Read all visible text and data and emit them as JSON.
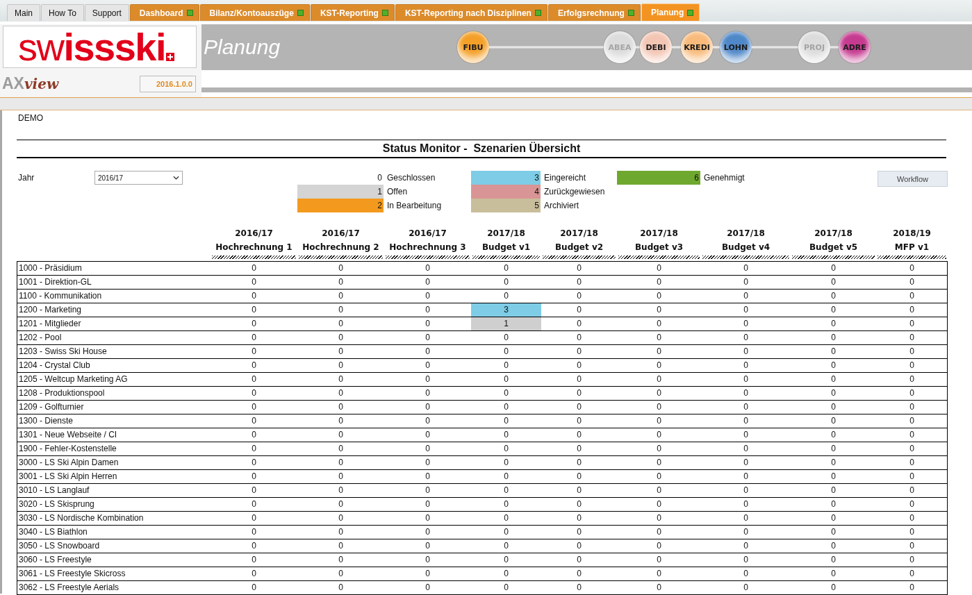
{
  "tabs": [
    {
      "label": "Main",
      "kind": "link",
      "selected": false
    },
    {
      "label": "How To",
      "kind": "link",
      "selected": false
    },
    {
      "label": "Support",
      "kind": "link",
      "selected": false
    },
    {
      "label": "Dashboard",
      "kind": "module",
      "selected": false
    },
    {
      "label": "Bilanz/Kontoauszüge",
      "kind": "module",
      "selected": false
    },
    {
      "label": "KST-Reporting",
      "kind": "module",
      "selected": false
    },
    {
      "label": "KST-Reporting nach Disziplinen",
      "kind": "module",
      "selected": false
    },
    {
      "label": "Erfolgsrechnung",
      "kind": "module",
      "selected": false
    },
    {
      "label": "Planung",
      "kind": "module",
      "selected": true
    }
  ],
  "header": {
    "logo": "sw**issski**",
    "product_logo": {
      "prefix": "AX",
      "suffix": "view"
    },
    "version": "2016.1.0.0",
    "title": "Planung",
    "modules": [
      {
        "label": "FIBU",
        "color": "#f4a028",
        "disabled": false
      },
      {
        "label": "ABEA",
        "color": "#dcdcdc",
        "disabled": true
      },
      {
        "label": "DEBI",
        "color": "#f3c6b4",
        "disabled": false
      },
      {
        "label": "KREDI",
        "color": "#f8bb7c",
        "disabled": false
      },
      {
        "label": "LOHN",
        "color": "#4f88c8",
        "disabled": false
      },
      {
        "label": "PROJ",
        "color": "#dcdcdc",
        "disabled": true
      },
      {
        "label": "ADRE",
        "color": "#c63a90",
        "disabled": false
      }
    ]
  },
  "client": "DEMO",
  "title": "Status Monitor -  Szenarien Übersicht",
  "year_filter": {
    "label": "Jahr",
    "value": "2016/17"
  },
  "legend": [
    {
      "code": "0",
      "label": "Geschlossen"
    },
    {
      "code": "1",
      "label": "Offen",
      "color": "#d4d4d4"
    },
    {
      "code": "2",
      "label": "In Bearbeitung",
      "color": "#f39a1e"
    },
    {
      "code": "3",
      "label": "Eingereicht",
      "color": "#7ecce6"
    },
    {
      "code": "4",
      "label": "Zurückgewiesen",
      "color": "#d99595"
    },
    {
      "code": "5",
      "label": "Archiviert",
      "color": "#c9be9b"
    },
    {
      "code": "6",
      "label": "Genehmigt",
      "color": "#6fa82e"
    }
  ],
  "workflow_button": "Workflow",
  "table": {
    "columns": [
      {
        "year": "2016/17",
        "name": "Hochrechnung 1"
      },
      {
        "year": "2016/17",
        "name": "Hochrechnung 2"
      },
      {
        "year": "2016/17",
        "name": "Hochrechnung 3"
      },
      {
        "year": "2017/18",
        "name": "Budget v1"
      },
      {
        "year": "2017/18",
        "name": "Budget v2"
      },
      {
        "year": "2017/18",
        "name": "Budget v3"
      },
      {
        "year": "2017/18",
        "name": "Budget v4"
      },
      {
        "year": "2017/18",
        "name": "Budget v5"
      },
      {
        "year": "2018/19",
        "name": "MFP v1"
      }
    ],
    "rows": [
      {
        "label": "1000 - Präsidium",
        "cells": [
          "0",
          "0",
          "0",
          "0",
          "0",
          "0",
          "0",
          "0",
          "0"
        ]
      },
      {
        "label": "1001 - Direktion-GL",
        "cells": [
          "0",
          "0",
          "0",
          "0",
          "0",
          "0",
          "0",
          "0",
          "0"
        ]
      },
      {
        "label": "1100 - Kommunikation",
        "cells": [
          "0",
          "0",
          "0",
          "0",
          "0",
          "0",
          "0",
          "0",
          "0"
        ]
      },
      {
        "label": "1200 - Marketing",
        "cells": [
          "0",
          "0",
          "0",
          {
            "text": "3",
            "color": "#7ecce6"
          },
          "0",
          "0",
          "0",
          "0",
          "0"
        ]
      },
      {
        "label": "1201 - Mitglieder",
        "cells": [
          "0",
          "0",
          "0",
          {
            "text": "1",
            "color": "#cfcfcf"
          },
          "0",
          "0",
          "0",
          "0",
          "0"
        ]
      },
      {
        "label": "1202 - Pool",
        "cells": [
          "0",
          "0",
          "0",
          "0",
          "0",
          "0",
          "0",
          "0",
          "0"
        ]
      },
      {
        "label": "1203 - Swiss Ski House",
        "cells": [
          "0",
          "0",
          "0",
          "0",
          "0",
          "0",
          "0",
          "0",
          "0"
        ]
      },
      {
        "label": "1204 - Crystal Club",
        "cells": [
          "0",
          "0",
          "0",
          "0",
          "0",
          "0",
          "0",
          "0",
          "0"
        ]
      },
      {
        "label": "1205 - Weltcup Marketing AG",
        "cells": [
          "0",
          "0",
          "0",
          "0",
          "0",
          "0",
          "0",
          "0",
          "0"
        ]
      },
      {
        "label": "1208 - Produktionspool",
        "cells": [
          "0",
          "0",
          "0",
          "0",
          "0",
          "0",
          "0",
          "0",
          "0"
        ]
      },
      {
        "label": "1209 - Golfturnier",
        "cells": [
          "0",
          "0",
          "0",
          "0",
          "0",
          "0",
          "0",
          "0",
          "0"
        ]
      },
      {
        "label": "1300 - Dienste",
        "cells": [
          "0",
          "0",
          "0",
          "0",
          "0",
          "0",
          "0",
          "0",
          "0"
        ]
      },
      {
        "label": "1301 - Neue Webseite / CI",
        "cells": [
          "0",
          "0",
          "0",
          "0",
          "0",
          "0",
          "0",
          "0",
          "0"
        ]
      },
      {
        "label": "1900 - Fehler-Kostenstelle",
        "cells": [
          "0",
          "0",
          "0",
          "0",
          "0",
          "0",
          "0",
          "0",
          "0"
        ]
      },
      {
        "label": "3000 - LS Ski Alpin Damen",
        "cells": [
          "0",
          "0",
          "0",
          "0",
          "0",
          "0",
          "0",
          "0",
          "0"
        ]
      },
      {
        "label": "3001 - LS Ski Alpin Herren",
        "cells": [
          "0",
          "0",
          "0",
          "0",
          "0",
          "0",
          "0",
          "0",
          "0"
        ]
      },
      {
        "label": "3010 - LS Langlauf",
        "cells": [
          "0",
          "0",
          "0",
          "0",
          "0",
          "0",
          "0",
          "0",
          "0"
        ]
      },
      {
        "label": "3020 - LS Skisprung",
        "cells": [
          "0",
          "0",
          "0",
          "0",
          "0",
          "0",
          "0",
          "0",
          "0"
        ]
      },
      {
        "label": "3030 - LS Nordische Kombination",
        "cells": [
          "0",
          "0",
          "0",
          "0",
          "0",
          "0",
          "0",
          "0",
          "0"
        ]
      },
      {
        "label": "3040 - LS Biathlon",
        "cells": [
          "0",
          "0",
          "0",
          "0",
          "0",
          "0",
          "0",
          "0",
          "0"
        ]
      },
      {
        "label": "3050 - LS Snowboard",
        "cells": [
          "0",
          "0",
          "0",
          "0",
          "0",
          "0",
          "0",
          "0",
          "0"
        ]
      },
      {
        "label": "3060 - LS Freestyle",
        "cells": [
          "0",
          "0",
          "0",
          "0",
          "0",
          "0",
          "0",
          "0",
          "0"
        ]
      },
      {
        "label": "3061 - LS Freestyle Skicross",
        "cells": [
          "0",
          "0",
          "0",
          "0",
          "0",
          "0",
          "0",
          "0",
          "0"
        ]
      },
      {
        "label": "3062 - LS Freestyle Aerials",
        "cells": [
          "0",
          "0",
          "0",
          "0",
          "0",
          "0",
          "0",
          "0",
          "0"
        ]
      }
    ]
  }
}
